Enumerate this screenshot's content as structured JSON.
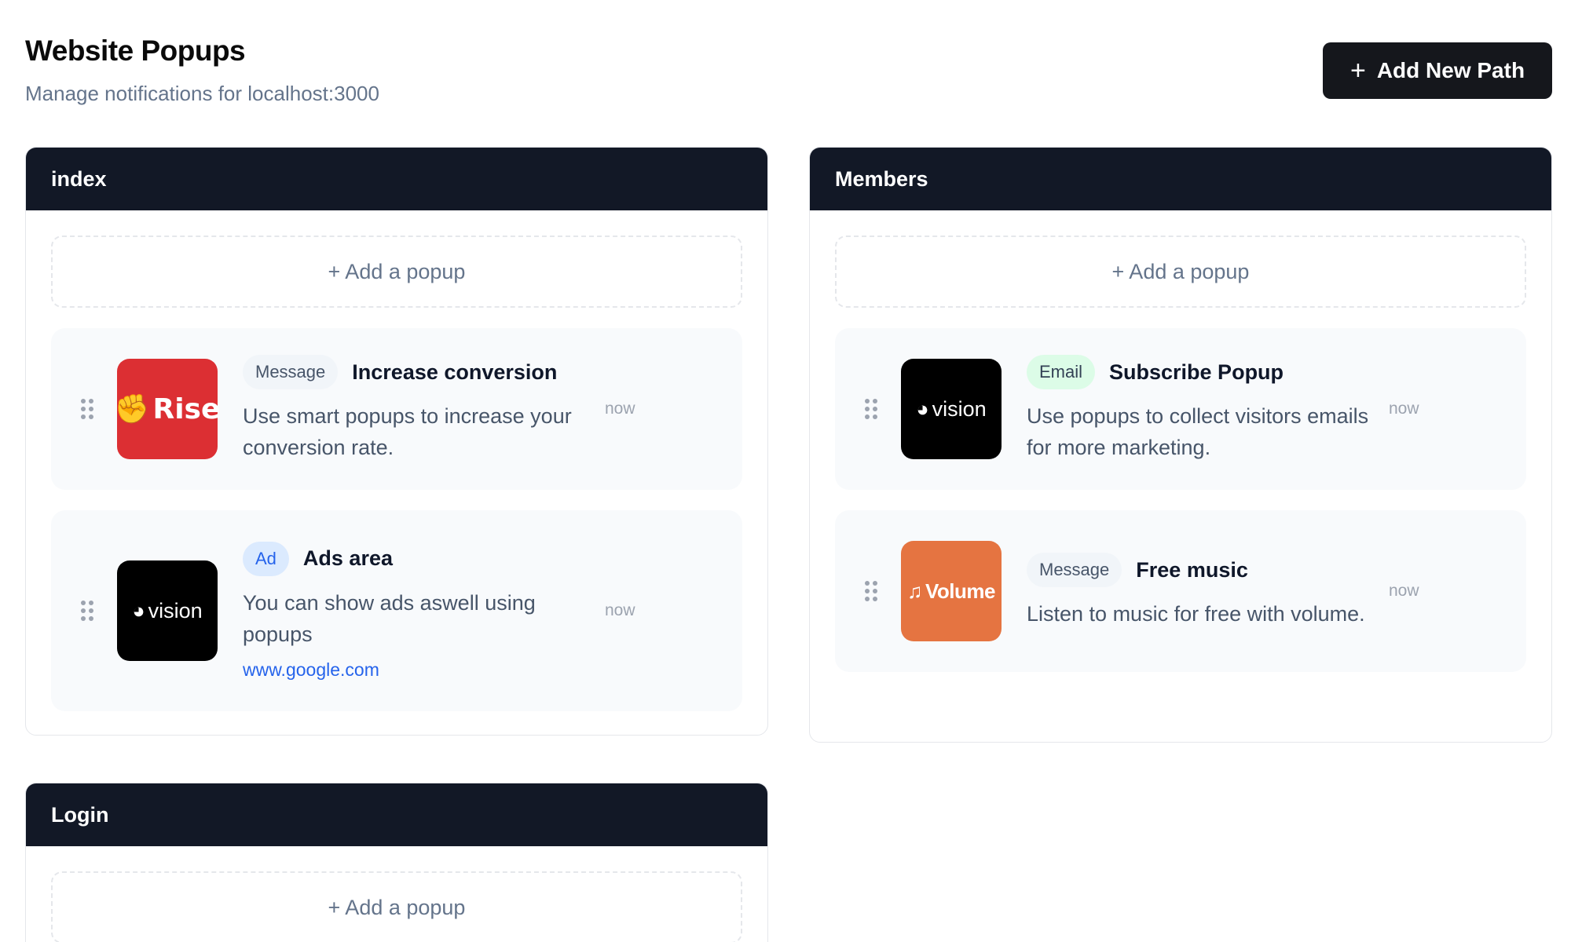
{
  "header": {
    "title": "Website Popups",
    "subtitle": "Manage notifications for localhost:3000",
    "add_path_label": "Add New Path"
  },
  "add_popup_label": "+ Add a popup",
  "panels": [
    {
      "title": "index",
      "cards": [
        {
          "logo_text": "Rise",
          "logo_icon": "fist-icon",
          "badge": "Message",
          "title": "Increase conversion",
          "desc": "Use smart popups to increase your conversion rate.",
          "time": "now",
          "color": "#dc2f33"
        },
        {
          "logo_text": "vision",
          "logo_icon": "vision-mark-icon",
          "badge": "Ad",
          "title": "Ads area",
          "desc": "You can show ads aswell using popups",
          "link": "www.google.com",
          "time": "now",
          "color": "#000000"
        }
      ]
    },
    {
      "title": "Members",
      "cards": [
        {
          "logo_text": "vision",
          "logo_icon": "vision-mark-icon",
          "badge": "Email",
          "title": "Subscribe Popup",
          "desc": "Use popups to collect visitors emails for more marketing.",
          "time": "now",
          "color": "#000000"
        },
        {
          "logo_text": "Volume",
          "logo_icon": "music-note-icon",
          "badge": "Message",
          "title": "Free music",
          "desc": "Listen to music for free with volume.",
          "time": "now",
          "color": "#e57441"
        }
      ]
    },
    {
      "title": "Login",
      "cards": []
    }
  ],
  "colors": {
    "panel_header": "#121826",
    "primary_button": "#15171c",
    "link": "#2563eb",
    "email_badge": "#dcfce7",
    "ad_badge": "#dbeafe"
  }
}
